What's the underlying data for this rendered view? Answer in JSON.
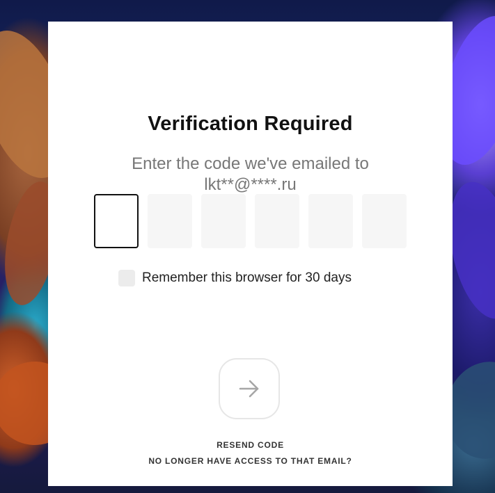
{
  "dialog": {
    "title": "Verification Required",
    "subtitle_line1": "Enter the code we've emailed to",
    "subtitle_line2": "lkt**@****.ru",
    "code_boxes": [
      "",
      "",
      "",
      "",
      "",
      ""
    ],
    "remember_label": "Remember this browser for 30 days",
    "remember_checked": false,
    "resend_label": "RESEND CODE",
    "no_access_label": "NO LONGER HAVE ACCESS TO THAT EMAIL?",
    "submit_icon": "arrow-right-icon"
  },
  "colors": {
    "panel": "#ffffff",
    "title": "#111111",
    "subtitle": "#777777",
    "code_box": "#f6f6f6",
    "active_border": "#111111",
    "arrow": "#a6a6a6"
  }
}
